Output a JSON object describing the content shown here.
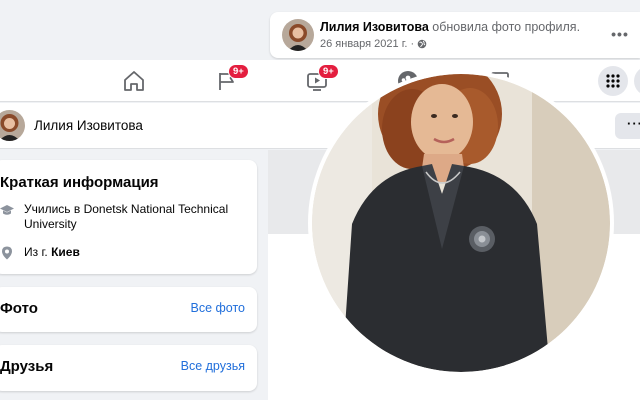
{
  "notification": {
    "name": "Лилия Изовитова",
    "action": "обновила фото профиля.",
    "date": "26 января 2021 г. ·",
    "more_icon": "more-horizontal-icon"
  },
  "nav": {
    "home_icon": "home-icon",
    "pages_icon": "flag-icon",
    "pages_badge": "9+",
    "watch_icon": "video-icon",
    "watch_badge": "9+",
    "groups_icon": "groups-icon",
    "gaming_icon": "gaming-icon",
    "menu_icon": "grid-menu-icon"
  },
  "profile_bar": {
    "name": "Лилия Изовитова",
    "more_label": "···"
  },
  "intro": {
    "title": "Краткая информация",
    "education": "Учились в Donetsk National Technical University",
    "hometown_prefix": "Из г.",
    "hometown": "Киев"
  },
  "photos": {
    "title": "Фото",
    "link": "Все фото"
  },
  "friends": {
    "title": "Друзья",
    "link": "Все друзья"
  },
  "colors": {
    "accent": "#216fdb",
    "badge": "#e41e3f",
    "background": "#f0f2f5"
  }
}
